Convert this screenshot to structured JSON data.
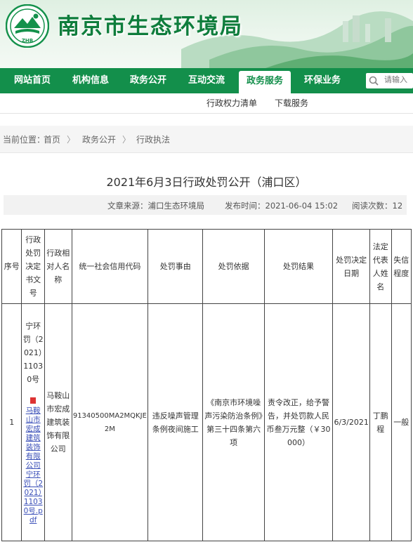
{
  "header": {
    "site_title": "南京市生态环境局",
    "logo_text": "ZHB"
  },
  "nav": {
    "items": [
      "网站首页",
      "机构信息",
      "政务公开",
      "互动交流",
      "政务服务",
      "环保业务"
    ],
    "active": "政务服务",
    "search_placeholder": "请输入"
  },
  "subnav": {
    "items": [
      "行政权力清单",
      "下载服务"
    ]
  },
  "breadcrumb": {
    "label": "当前位置：",
    "items": [
      "首页",
      "政务公开",
      "行政执法"
    ],
    "separator": "〉"
  },
  "article": {
    "title": "2021年6月3日行政处罚公开（浦口区）",
    "source": "文章来源：浦口生态环境局",
    "publish_time": "发布时间：2021-06-04 15:02",
    "views": "阅读次数：12"
  },
  "table": {
    "headers": [
      "序号",
      "行政处罚决定书文号",
      "行政相对人名称",
      "统一社会信用代码",
      "处罚事由",
      "处罚依据",
      "处罚结果",
      "处罚决定日期",
      "法定代表人姓名",
      "失信程度"
    ],
    "rows": [
      {
        "index": "1",
        "doc_no": "宁环罚（2021）11030号",
        "attachment": "马鞍山市宏成建筑装饰有限公司 宁环罚（2021）11030号.pdf",
        "party": "马鞍山市宏成建筑装饰有限公司",
        "credit_code": "91340500MA2MQKJE2M",
        "reason": "违反噪声管理条例夜间施工",
        "basis": "《南京市环境噪声污染防治条例》第三十四条第六项",
        "result": "责令改正，给予警告，并处罚款人民币叁万元整（￥30000）",
        "date": "6/3/2021",
        "legal_rep": "丁鹏程",
        "credit_level": "一般"
      }
    ]
  }
}
